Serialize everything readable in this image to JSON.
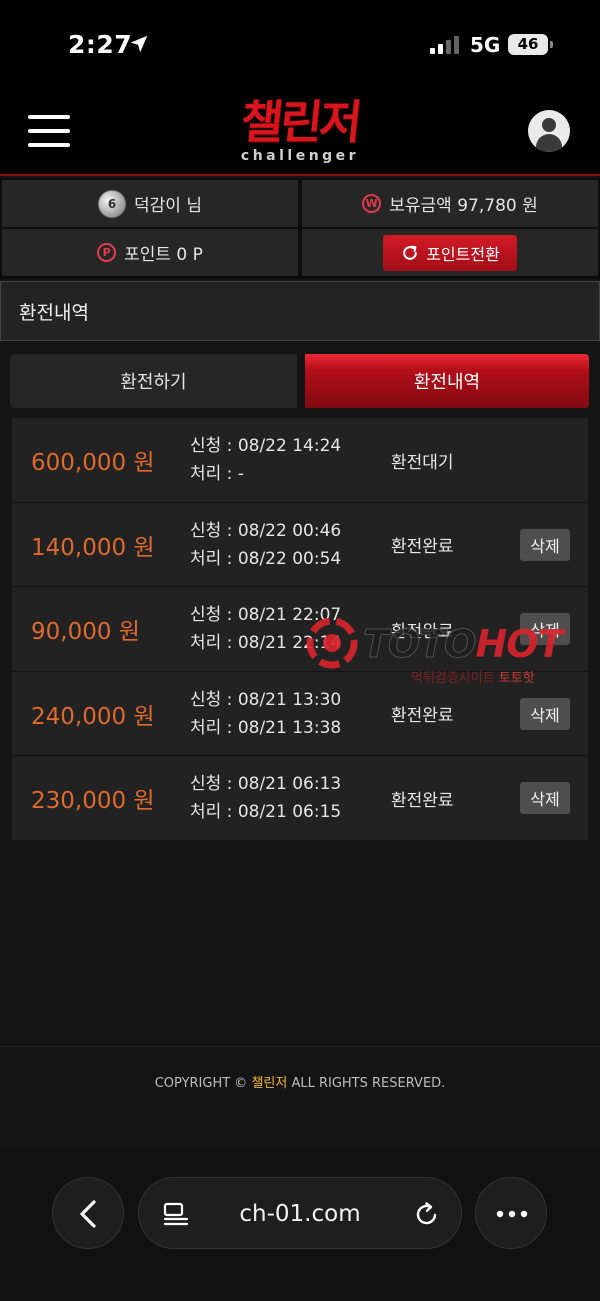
{
  "status_bar": {
    "time": "2:27",
    "network": "5G",
    "battery": "46"
  },
  "header": {
    "logo_kr": "챌린저",
    "logo_en": "challenger",
    "menu_icon": "hamburger-menu-icon",
    "profile_icon": "user-profile-icon"
  },
  "user": {
    "level": "6",
    "nickname": "덕감이 님",
    "balance_label": "보유금액 97,780 원",
    "points_label": "포인트 0 P",
    "convert_button": "포인트전환",
    "won_glyph": "W",
    "point_glyph": "P"
  },
  "section": {
    "title": "환전내역"
  },
  "tabs": [
    {
      "label": "환전하기",
      "active": false
    },
    {
      "label": "환전내역",
      "active": true
    }
  ],
  "history": [
    {
      "amount": "600,000 원",
      "requested": "신청 : 08/22 14:24",
      "processed": "처리 : -",
      "status": "환전대기",
      "delete": ""
    },
    {
      "amount": "140,000 원",
      "requested": "신청 : 08/22 00:46",
      "processed": "처리 : 08/22 00:54",
      "status": "환전완료",
      "delete": "삭제"
    },
    {
      "amount": "90,000 원",
      "requested": "신청 : 08/21 22:07",
      "processed": "처리 : 08/21 22:14",
      "status": "환전완료",
      "delete": "삭제"
    },
    {
      "amount": "240,000 원",
      "requested": "신청 : 08/21 13:30",
      "processed": "처리 : 08/21 13:38",
      "status": "환전완료",
      "delete": "삭제"
    },
    {
      "amount": "230,000 원",
      "requested": "신청 : 08/21 06:13",
      "processed": "처리 : 08/21 06:15",
      "status": "환전완료",
      "delete": "삭제"
    }
  ],
  "watermark": {
    "text_a": "TOTO",
    "text_b": "HOT",
    "sub_a": "먹튀검증사이트 ",
    "sub_b": "토토핫"
  },
  "footer": {
    "copyright_pre": "COPYRIGHT © ",
    "brand": "챌린저",
    "copyright_post": " ALL RIGHTS RESERVED."
  },
  "browser": {
    "url": "ch-01.com"
  },
  "colors": {
    "accent_red": "#d41b27",
    "amount_orange": "#df6a2d",
    "brand_yellow": "#f1b928"
  }
}
